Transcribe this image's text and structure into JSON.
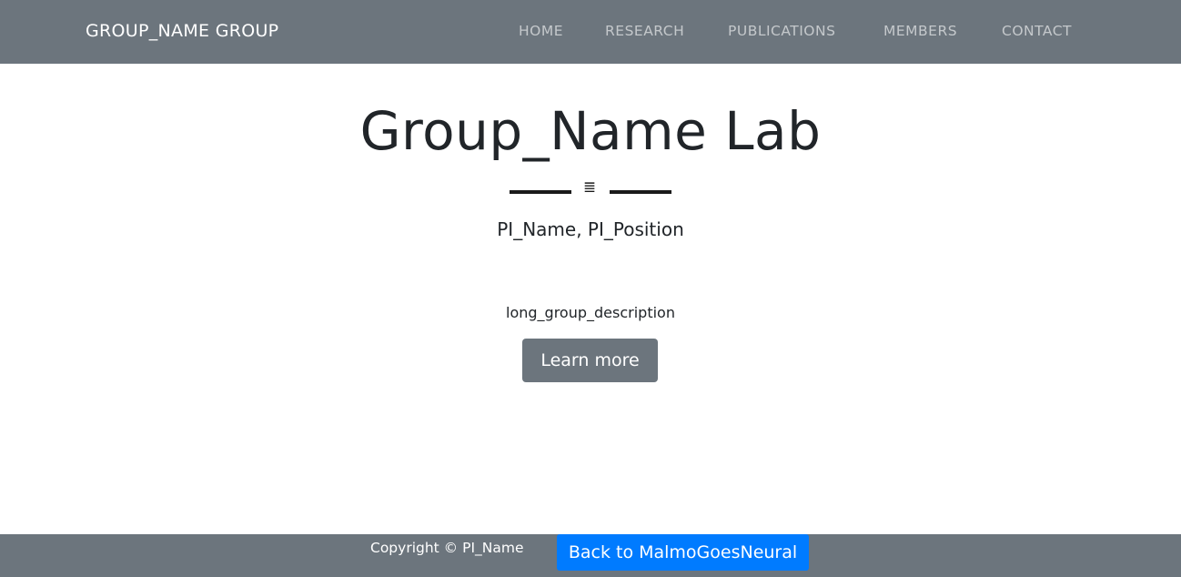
{
  "navbar": {
    "brand": "GROUP_NAME GROUP",
    "links": [
      "HOME",
      "RESEARCH",
      "PUBLICATIONS",
      "MEMBERS",
      "CONTACT"
    ],
    "background": "#6c757d"
  },
  "masthead": {
    "title": "Group_Name Lab",
    "divider_icon": "list-icon",
    "divider_glyph": "≣",
    "subheading": "PI_Name, PI_Position",
    "description": "long_group_description",
    "learn_more_label": "Learn more"
  },
  "footer": {
    "copyright": "Copyright © PI_Name",
    "back_label": "Back to MalmoGoesNeural",
    "back_color": "#007bff"
  }
}
